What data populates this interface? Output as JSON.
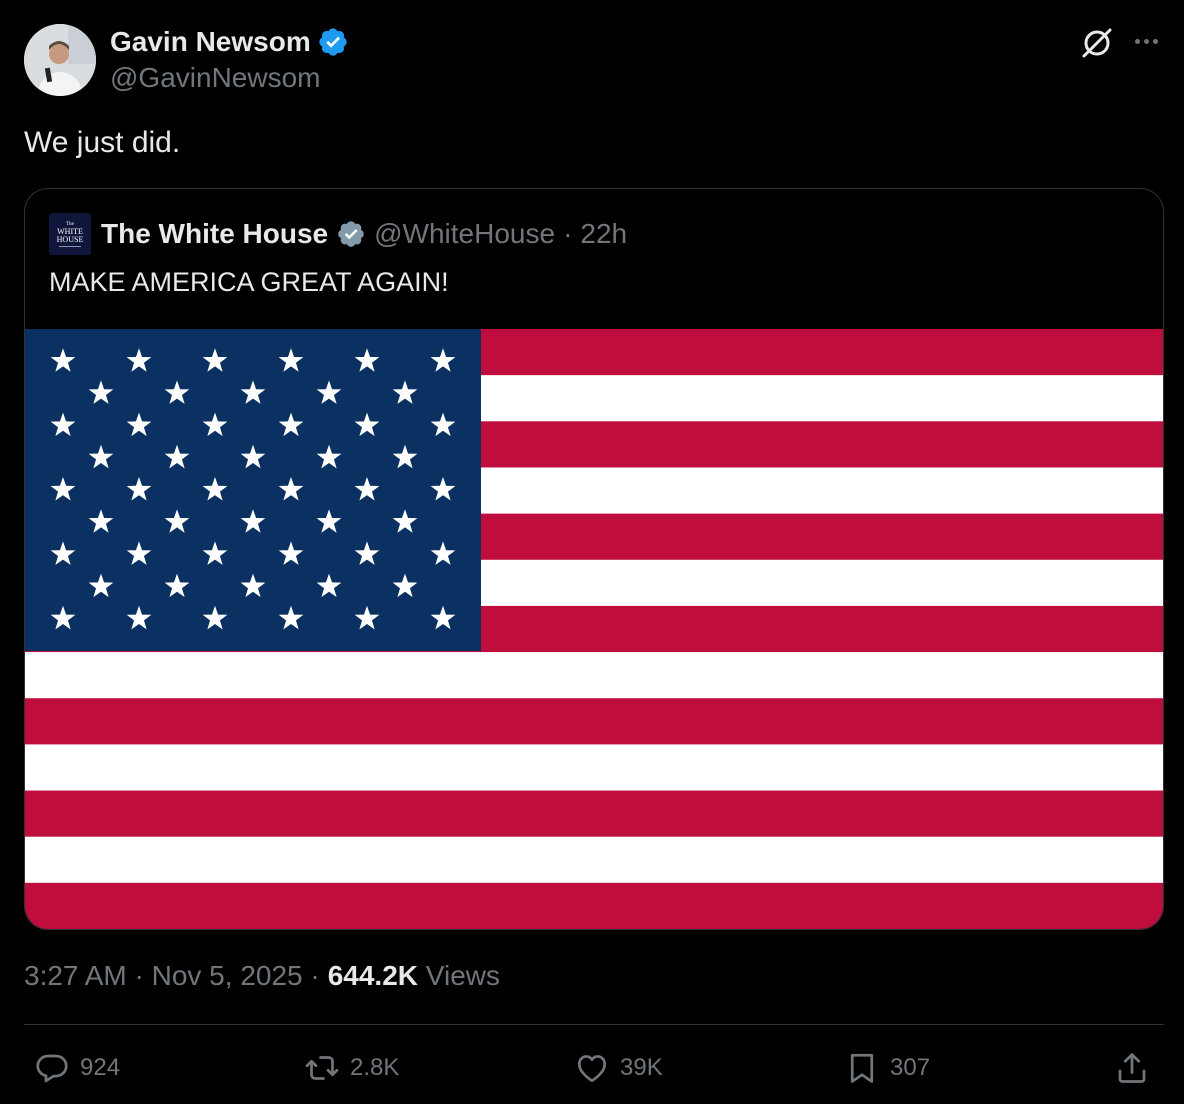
{
  "post": {
    "author": {
      "name": "Gavin Newsom",
      "handle": "@GavinNewsom",
      "verified": true
    },
    "text": "We just did.",
    "timestamp": "3:27 AM · Nov 5, 2025 ·",
    "views_count": "644.2K",
    "views_label": "Views"
  },
  "quote": {
    "name": "The White House",
    "handle": "@WhiteHouse",
    "separator": "·",
    "time": "22h",
    "text": "MAKE AMERICA GREAT AGAIN!",
    "avatar_text_small": "The",
    "avatar_text_main": "WHITE HOUSE",
    "image": "american-flag"
  },
  "actions": {
    "replies": "924",
    "reposts": "2.8K",
    "likes": "39K",
    "bookmarks": "307"
  },
  "colors": {
    "background": "#000000",
    "text": "#e7e9ea",
    "secondary": "#71767b",
    "verified_blue": "#1d9bf0",
    "verified_gray": "#829aab",
    "flag_red": "#bf0d3e",
    "flag_blue": "#0a3161",
    "border": "#2f3336"
  },
  "icons": [
    "verified-badge-icon",
    "grok-icon",
    "more-icon",
    "reply-icon",
    "repost-icon",
    "like-icon",
    "bookmark-icon",
    "share-icon"
  ]
}
